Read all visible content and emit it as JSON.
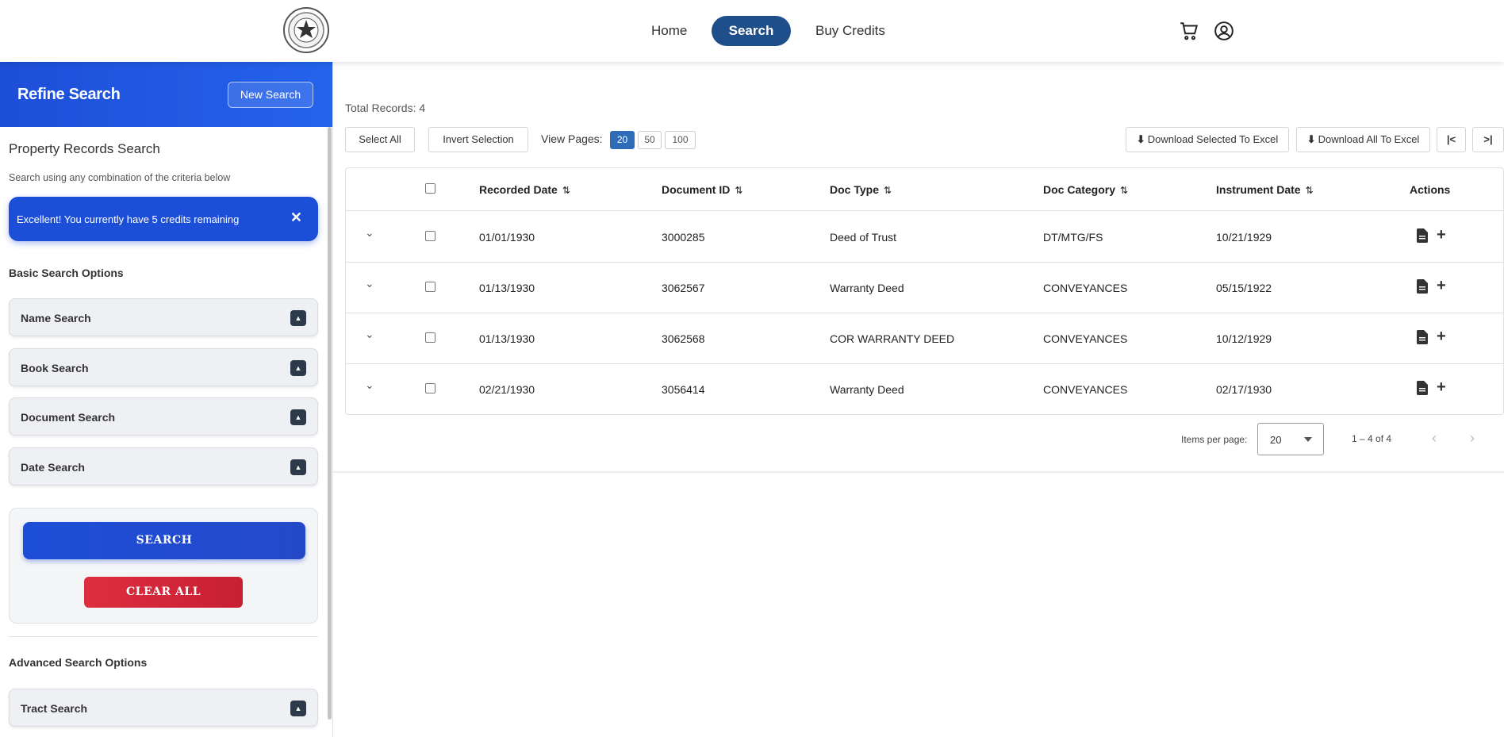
{
  "nav": {
    "home": "Home",
    "search": "Search",
    "buy_credits": "Buy Credits",
    "logo": "county-seal",
    "cart_icon": "cart-icon",
    "user_icon": "user-circle-icon"
  },
  "sidebar": {
    "title": "Refine Search",
    "new_search": "New Search",
    "heading": "Property Records Search",
    "subheading": "Search using any combination of the criteria below",
    "alert": "Excellent! You currently have 5 credits remaining",
    "basic_label": "Basic Search Options",
    "basic_items": [
      "Name Search",
      "Book Search",
      "Document Search",
      "Date Search"
    ],
    "search_button": "SEARCH",
    "clear_button": "CLEAR ALL",
    "advanced_label": "Advanced Search Options",
    "advanced_items": [
      "Tract Search"
    ]
  },
  "main": {
    "total": "Total Records: 4",
    "select_all": "Select All",
    "invert_selection": "Invert Selection",
    "view_pages_label": "View Pages:",
    "view_pages": [
      "20",
      "50",
      "100"
    ],
    "view_pages_active": "20",
    "download_selected": "Download Selected To Excel",
    "download_all": "Download All To Excel",
    "first_page": "|<",
    "last_page": ">|",
    "columns": [
      "Recorded Date",
      "Document ID",
      "Doc Type",
      "Doc Category",
      "Instrument Date",
      "Actions"
    ],
    "rows": [
      {
        "recorded": "01/01/1930",
        "doc_id": "3000285",
        "type": "Deed of Trust",
        "category": "DT/MTG/FS",
        "instrument": "10/21/1929"
      },
      {
        "recorded": "01/13/1930",
        "doc_id": "3062567",
        "type": "Warranty Deed",
        "category": "CONVEYANCES",
        "instrument": "05/15/1922"
      },
      {
        "recorded": "01/13/1930",
        "doc_id": "3062568",
        "type": "COR WARRANTY DEED",
        "category": "CONVEYANCES",
        "instrument": "10/12/1929"
      },
      {
        "recorded": "02/21/1930",
        "doc_id": "3056414",
        "type": "Warranty Deed",
        "category": "CONVEYANCES",
        "instrument": "02/17/1930"
      }
    ],
    "items_per_page_label": "Items per page:",
    "items_per_page": "20",
    "range": "1 – 4 of 4"
  },
  "colors": {
    "brand_blue": "#1d4ed8",
    "nav_active": "#1f4f8a",
    "clear_red": "#dc2e3f"
  }
}
